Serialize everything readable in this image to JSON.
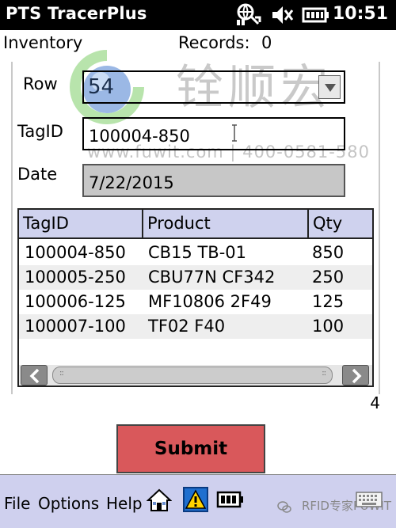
{
  "titlebar": {
    "title": "PTS TracerPlus",
    "time": "10:51",
    "icons": [
      "connectivity-icon",
      "volume-icon",
      "battery-icon"
    ]
  },
  "header": {
    "section": "Inventory",
    "records_label": "Records:",
    "records_value": "0"
  },
  "watermark": {
    "chinese": "铨顺宏",
    "url": "www.fuwit.com | 400-0581-580"
  },
  "form": {
    "row_label": "Row",
    "row_value": "54",
    "tagid_label": "TagID",
    "tagid_value": "100004-850",
    "date_label": "Date",
    "date_value": "7/22/2015"
  },
  "grid": {
    "columns": [
      "TagID",
      "Product",
      "Qty"
    ],
    "rows": [
      [
        "100004-850",
        "CB15 TB-01",
        "850"
      ],
      [
        "100005-250",
        "CBU77N CF342",
        "250"
      ],
      [
        "100006-125",
        "MF10806 2F49",
        "125"
      ],
      [
        "100007-100",
        "TF02 F40",
        "100"
      ]
    ],
    "count": "4"
  },
  "submit_label": "Submit",
  "menu": {
    "file": "File",
    "options": "Options",
    "help": "Help",
    "wechat": "RFID专家FUWIT"
  },
  "colors": {
    "titlebar": "#000000",
    "menubar": "#cfd0ee",
    "grid_header": "#cfd2ee",
    "submit": "#d9585b",
    "date_field": "#c7c7c7"
  }
}
